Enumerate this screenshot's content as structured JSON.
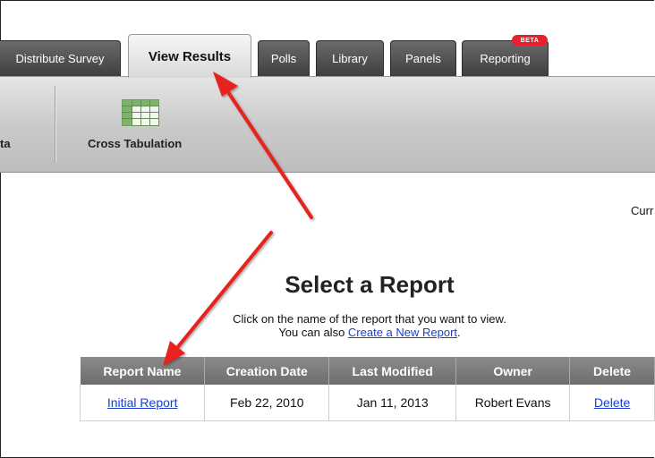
{
  "tabs": [
    {
      "label": "Distribute Survey",
      "active": false
    },
    {
      "label": "View Results",
      "active": true
    },
    {
      "label": "Polls",
      "active": false
    },
    {
      "label": "Library",
      "active": false
    },
    {
      "label": "Panels",
      "active": false
    },
    {
      "label": "Reporting",
      "active": false,
      "badge": "BETA"
    }
  ],
  "toolbar": {
    "partial_label": "ta",
    "cross_tabulation_label": "Cross Tabulation",
    "cross_tabulation_icon": "table-grid-icon"
  },
  "main": {
    "curr_partial": "Curr",
    "title": "Select a Report",
    "instruction": "Click on the name of the report that you want to view.",
    "also_prefix": "You can also ",
    "create_link": "Create a New Report",
    "also_suffix": "."
  },
  "reports_table": {
    "headers": [
      "Report Name",
      "Creation Date",
      "Last Modified",
      "Owner",
      "Delete"
    ],
    "rows": [
      {
        "name": "Initial Report",
        "created": "Feb 22, 2010",
        "modified": "Jan 11, 2013",
        "owner": "Robert Evans",
        "delete": "Delete"
      }
    ]
  },
  "colors": {
    "annotation_arrow": "#e8201c",
    "link": "#1a3fcc",
    "badge": "#e8212d"
  }
}
